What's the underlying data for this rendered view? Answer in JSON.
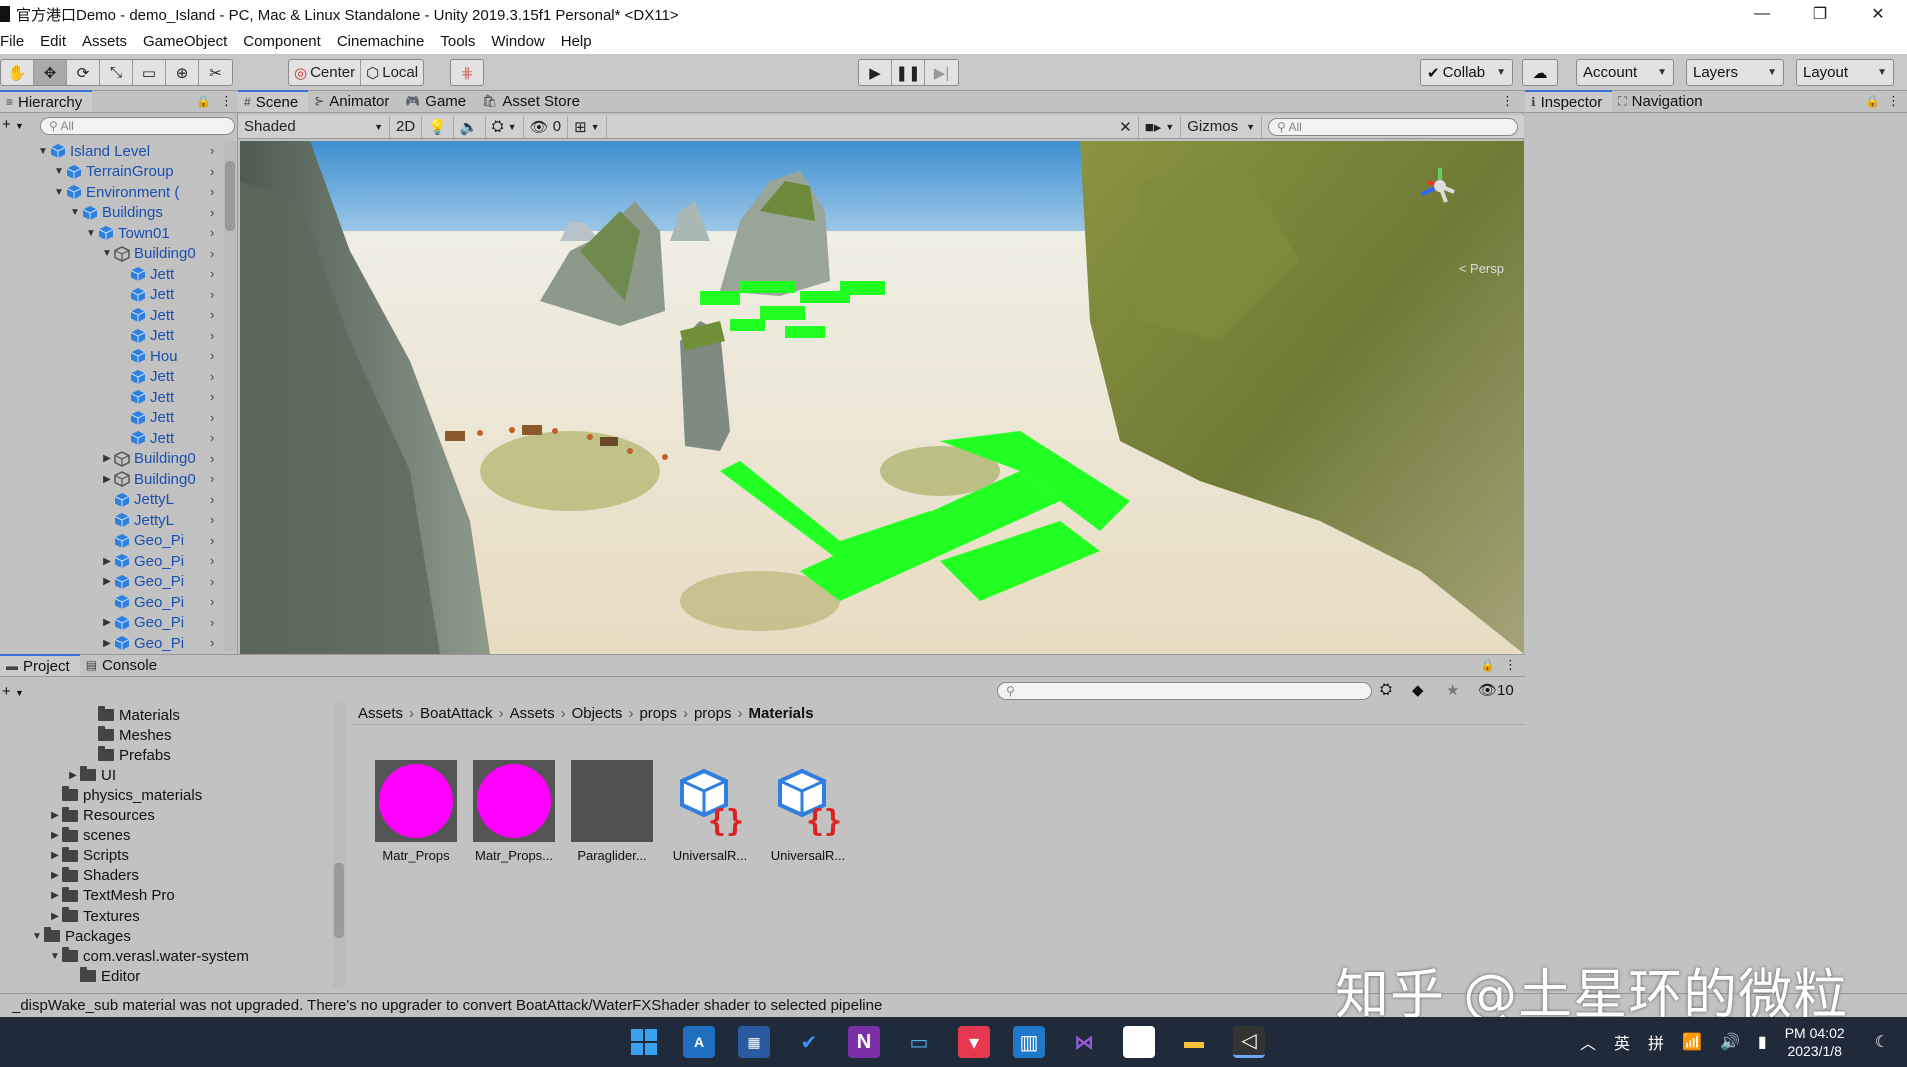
{
  "window": {
    "title": "官方港口Demo - demo_Island - PC, Mac & Linux Standalone - Unity 2019.3.15f1 Personal* <DX11>",
    "controls": [
      "—",
      "❐",
      "✕"
    ]
  },
  "menu": [
    "File",
    "Edit",
    "Assets",
    "GameObject",
    "Component",
    "Cinemachine",
    "Tools",
    "Window",
    "Help"
  ],
  "toolbar": {
    "pivot": "Center",
    "space": "Local",
    "collab": "Collab",
    "account": "Account",
    "layers": "Layers",
    "layout": "Layout"
  },
  "hierarchy": {
    "tab": "Hierarchy",
    "add": "+",
    "search_placeholder": "All",
    "rows": [
      {
        "label": "Island Level",
        "indent": 0
      },
      {
        "label": "TerrainGroup",
        "indent": 1
      },
      {
        "label": "Environment (",
        "indent": 1
      },
      {
        "label": "Buildings",
        "indent": 2
      },
      {
        "label": "Town01",
        "indent": 3
      },
      {
        "label": "Building0",
        "indent": 4
      },
      {
        "label": "Jett",
        "indent": 5
      },
      {
        "label": "Jett",
        "indent": 5
      },
      {
        "label": "Jett",
        "indent": 5
      },
      {
        "label": "Jett",
        "indent": 5
      },
      {
        "label": "Hou",
        "indent": 5
      },
      {
        "label": "Jett",
        "indent": 5
      },
      {
        "label": "Jett",
        "indent": 5
      },
      {
        "label": "Jett",
        "indent": 5
      },
      {
        "label": "Jett",
        "indent": 5
      },
      {
        "label": "Building0",
        "indent": 4
      },
      {
        "label": "Building0",
        "indent": 4
      },
      {
        "label": "JettyL",
        "indent": 4
      },
      {
        "label": "JettyL",
        "indent": 4
      },
      {
        "label": "Geo_Pi",
        "indent": 4
      },
      {
        "label": "Geo_Pi",
        "indent": 4
      },
      {
        "label": "Geo_Pi",
        "indent": 4
      },
      {
        "label": "Geo_Pi",
        "indent": 4
      },
      {
        "label": "Geo_Pi",
        "indent": 4
      },
      {
        "label": "Geo_Pi",
        "indent": 4
      },
      {
        "label": "Geo_Pi",
        "indent": 4
      }
    ]
  },
  "scene": {
    "tabs": [
      "Scene",
      "Animator",
      "Game",
      "Asset Store"
    ],
    "shading": "Shaded",
    "mode_2d": "2D",
    "hidden_count": "0",
    "gizmos": "Gizmos",
    "search_placeholder": "All",
    "persp_label": "< Persp"
  },
  "inspector": {
    "tabs": [
      "Inspector",
      "Navigation"
    ]
  },
  "project": {
    "tabs": [
      "Project",
      "Console"
    ],
    "hidden_count": "10",
    "tree": [
      {
        "label": "Materials",
        "indent": 3
      },
      {
        "label": "Meshes",
        "indent": 3
      },
      {
        "label": "Prefabs",
        "indent": 3
      },
      {
        "label": "UI",
        "indent": 2
      },
      {
        "label": "physics_materials",
        "indent": 1
      },
      {
        "label": "Resources",
        "indent": 1
      },
      {
        "label": "scenes",
        "indent": 1
      },
      {
        "label": "Scripts",
        "indent": 1
      },
      {
        "label": "Shaders",
        "indent": 1
      },
      {
        "label": "TextMesh Pro",
        "indent": 1
      },
      {
        "label": "Textures",
        "indent": 1
      },
      {
        "label": "Packages",
        "indent": 0
      },
      {
        "label": "com.verasl.water-system",
        "indent": 1
      },
      {
        "label": "Editor",
        "indent": 2
      }
    ],
    "breadcrumb": [
      "Assets",
      "BoatAttack",
      "Assets",
      "Objects",
      "props",
      "props",
      "Materials"
    ],
    "assets": [
      {
        "label": "Matr_Props",
        "kind": "magenta-sphere"
      },
      {
        "label": "Matr_Props...",
        "kind": "magenta-sphere"
      },
      {
        "label": "Paraglider...",
        "kind": "dark-square"
      },
      {
        "label": "UniversalR...",
        "kind": "render-pipeline-asset"
      },
      {
        "label": "UniversalR...",
        "kind": "render-pipeline-asset"
      }
    ]
  },
  "status": {
    "message": "_dispWake_sub material was not upgraded. There's no upgrader to convert BoatAttack/WaterFXShader shader to selected pipeline"
  },
  "watermark": "知乎 @土星环的微粒",
  "taskbar": {
    "ime_lang": "英",
    "ime_mode": "拼",
    "time": "PM 04:02",
    "date": "2023/1/8"
  },
  "colors": {
    "accent_blue": "#3a72d8",
    "hierarchy_text": "#1a4fb0",
    "magenta": "#ff00ff",
    "highlight_green": "#22ff22"
  }
}
